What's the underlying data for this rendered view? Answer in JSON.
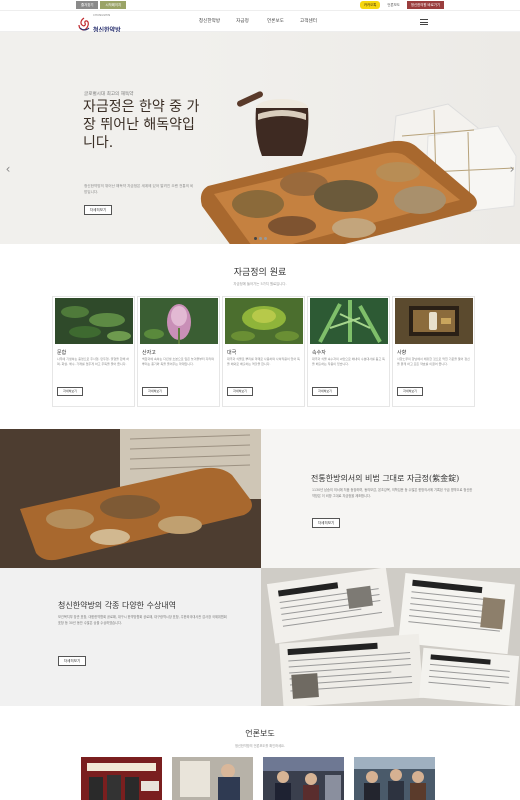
{
  "topbar": {
    "left_buttons": [
      "즐겨찾기",
      "시작페이지"
    ],
    "kakao": "카카오톡",
    "press": "언론보도",
    "inquiry": "청신한의원 바로가기"
  },
  "header": {
    "logo_text": "청신한약방",
    "logo_sub": "CHUNGSHIN",
    "nav": [
      "청신한약방",
      "자금정",
      "언론보도",
      "고객센터"
    ]
  },
  "hero": {
    "kicker": "글로벌시대 최고의 해독약",
    "title": "자금정은 한약 중 가장 뛰어난 해독약입니다.",
    "desc": "청신한약방의 뛰어난 해독약 자금정은 세계에 있어 알려진 오랜 전통의 비방입니다.",
    "button": "자세히보기",
    "prev": "‹",
    "next": "›"
  },
  "ingredients": {
    "title": "자금정의 원료",
    "subtitle": "자금정에 들어가는 5가지 원료입니다.",
    "cards": [
      {
        "name": "문합",
        "text": "나무에 기생하는 충영으로 주사형, 만두형, 궐형을 합해 하며, 화살, 해수, 가래를 멈추게 하고 주독을 풀어 줍니다.",
        "button": "자세히보기"
      },
      {
        "name": "산자고",
        "text": "백합과에 속하는 다년생 초본으로 잎은 늦겨울부터 자라며 뿌리는 종기와 독을 풀어주는 약재입니다.",
        "button": "자세히보기"
      },
      {
        "name": "대극",
        "text": "대극과 식물로 뿌리를 약재로 사용하며 사하작용이 있어 독을 체외로 배출하는 역할을 합니다.",
        "button": "자세히보기"
      },
      {
        "name": "속수자",
        "text": "대극과 식물 속수자의 씨앗으로 체내의 수분대사를 돕고 독을 배출하는 작용이 있습니다.",
        "button": "자세히보기"
      },
      {
        "name": "사향",
        "text": "사향노루의 향낭에서 채취한 것으로 막힌 기운을 뚫어 정신을 맑게 하고 모든 약효를 이끌어 줍니다.",
        "button": "자세히보기"
      }
    ]
  },
  "tradition": {
    "title": "전통한방의서의 비법 그대로 자금정(紫金錠)",
    "desc": "1130년 남송의 의서에 처음 등장하며, 동의보감, 본초강목, 의학입문 등 수많은 한방의서에 기록된 구급 명약으로 청신한약방은 이 비방 그대로 자금정을 제조합니다.",
    "button": "자세히보기"
  },
  "awards": {
    "title": "청신한약방의 각종 다양한 수상내역",
    "desc": "보건복지부 장관 표창, 대한한약협회 공로패, 대구시 한약방협회 공로패, 대구광역시장 표창, 주한외국대사관 감사장 국제위원회 표창 등 30년 동안 수많은 상을 수상하였습니다.",
    "button": "자세히보기"
  },
  "press": {
    "title": "언론보도",
    "subtitle": "청신한약방의 언론보도를 확인하세요."
  }
}
